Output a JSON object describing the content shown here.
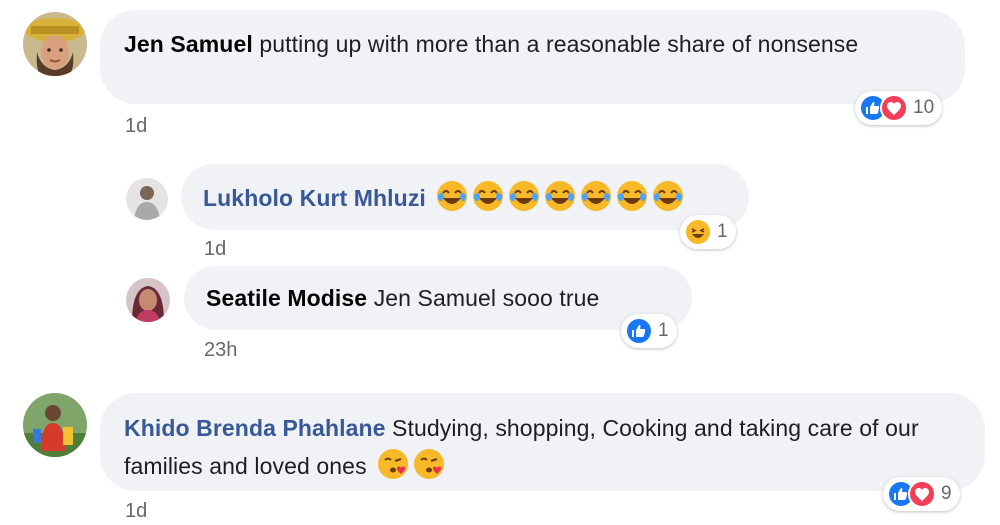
{
  "comments": [
    {
      "author": "Jen Samuel",
      "text": "putting up with more than a reasonable share of nonsense",
      "time": "1d",
      "reaction_count": "10",
      "reactions": [
        "like-icon",
        "angry-icon"
      ]
    },
    {
      "author": "Khido Brenda Phahlane",
      "text": "Studying, shopping, Cooking and taking care of our families and loved ones",
      "time": "1d",
      "reaction_count": "9",
      "reactions": [
        "like-icon",
        "angry-icon"
      ],
      "trailing_emojis": [
        "kissing-heart-emoji",
        "kissing-heart-emoji"
      ]
    }
  ],
  "replies": [
    {
      "author": "Lukholo Kurt Mhluzi",
      "text_emojis": [
        "laugh-cry-emoji",
        "laugh-cry-emoji",
        "laugh-cry-emoji",
        "laugh-cry-emoji",
        "laugh-cry-emoji",
        "laugh-cry-emoji",
        "laugh-cry-emoji"
      ],
      "time": "1d",
      "reaction_count": "1",
      "reactions": [
        "haha-icon"
      ]
    },
    {
      "author": "Seatile Modise",
      "text": "Jen Samuel sooo true",
      "time": "23h",
      "reaction_count": "1",
      "reactions": [
        "like-icon"
      ]
    }
  ],
  "colors": {
    "bubble": "#f0f2f5",
    "link_name": "#385898",
    "like": "#1877f2",
    "angry": "#f33e58",
    "meta": "#65676b"
  }
}
